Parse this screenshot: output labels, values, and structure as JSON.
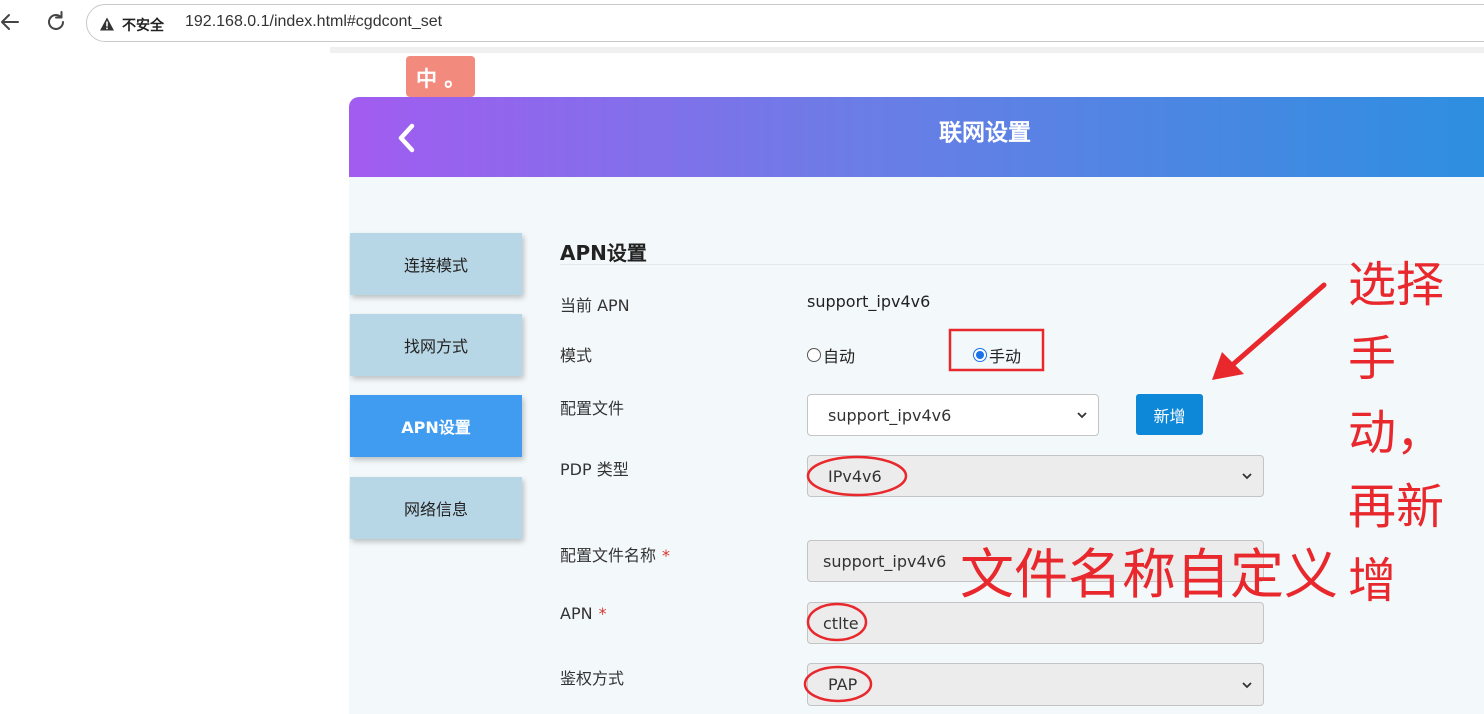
{
  "browser": {
    "security_label": "不安全",
    "url": "192.168.0.1/index.html#cgdcont_set"
  },
  "lang_badge": "中 。",
  "header": {
    "title": "联网设置"
  },
  "sidebar": {
    "items": [
      {
        "label": "连接模式",
        "active": false
      },
      {
        "label": "找网方式",
        "active": false
      },
      {
        "label": "APN设置",
        "active": true
      },
      {
        "label": "网络信息",
        "active": false
      }
    ]
  },
  "apn": {
    "section_title": "APN设置",
    "current_apn_label": "当前 APN",
    "current_apn_value": "support_ipv4v6",
    "mode_label": "模式",
    "mode_options": [
      "自动",
      "手动"
    ],
    "mode_selected": "手动",
    "profile_label": "配置文件",
    "profile_value": "support_ipv4v6",
    "add_button": "新增",
    "pdp_label": "PDP 类型",
    "pdp_value": "IPv4v6",
    "profile_name_label": "配置文件名称",
    "profile_name_value": "support_ipv4v6",
    "apn_label": "APN",
    "apn_value": "ctlte",
    "required_mark": "*",
    "auth_label": "鉴权方式",
    "auth_value": "PAP"
  },
  "annotations": {
    "right_note": "选择手动，再新增",
    "bottom_note": "文件名称自定义",
    "color": "#e8282c"
  },
  "colors": {
    "header_gradient_start": "#a25cf0",
    "header_gradient_end": "#2d8fe0",
    "sidebar_active": "#3f9cf0",
    "sidebar_item": "#b8d7e6",
    "add_button": "#0d87d8"
  }
}
